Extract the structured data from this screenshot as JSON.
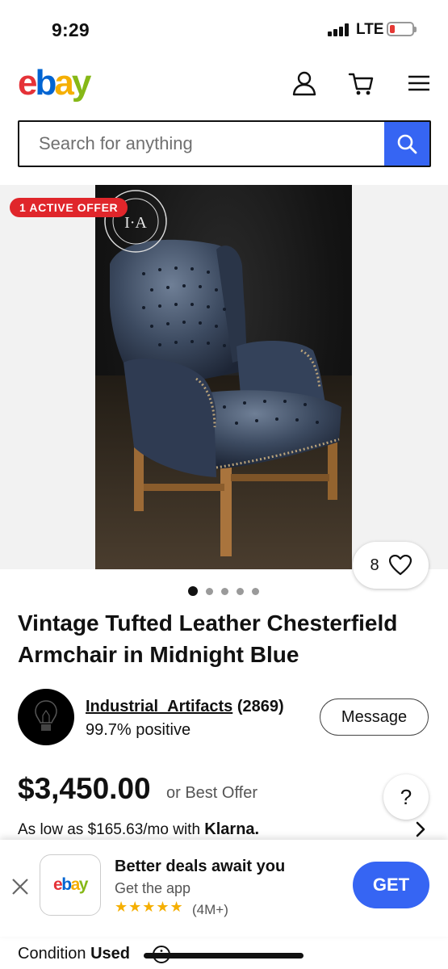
{
  "status_bar": {
    "time": "9:29",
    "network": "LTE"
  },
  "header": {
    "logo_letters": [
      "e",
      "b",
      "a",
      "y"
    ],
    "icons": [
      "user-icon",
      "cart-icon",
      "menu-icon"
    ]
  },
  "search": {
    "placeholder": "Search for anything",
    "icon": "search-icon"
  },
  "gallery": {
    "badge": "1 ACTIVE OFFER",
    "watermark": "I·A",
    "watch_count": "8",
    "image_count": 5,
    "active_index": 0
  },
  "listing": {
    "title": "Vintage Tufted Leather Chesterfield Armchair in Midnight Blue"
  },
  "seller": {
    "name": "Industrial_Artifacts",
    "score": "(2869)",
    "positive": "99.7% positive",
    "message_label": "Message"
  },
  "price": {
    "amount": "$3,450.00",
    "best_offer": "or Best Offer",
    "help": "?",
    "installment_prefix": "As low as $165.63/mo with",
    "installment_provider": "Klarna."
  },
  "app_banner": {
    "title": "Better deals await you",
    "subtitle": "Get the app",
    "stars": "★★★★★",
    "reviews": "(4M+)",
    "get_label": "GET"
  },
  "condition": {
    "label": "Condition",
    "value": "Used"
  },
  "colors": {
    "accent_blue": "#3665f3",
    "offer_red": "#e0262b",
    "logo_red": "#e53238",
    "logo_blue": "#0064d2",
    "logo_yellow": "#f5af02",
    "logo_green": "#86b817"
  }
}
